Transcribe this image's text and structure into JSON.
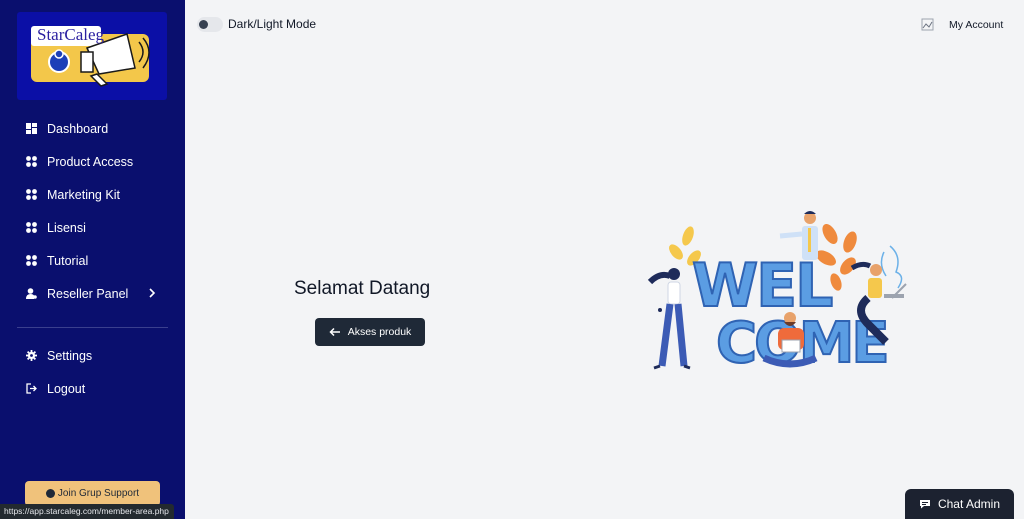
{
  "sidebar": {
    "logo_text": "StarCaleg",
    "items": [
      {
        "label": "Dashboard",
        "icon": "dashboard-icon"
      },
      {
        "label": "Product Access",
        "icon": "grid-icon"
      },
      {
        "label": "Marketing Kit",
        "icon": "grid-icon"
      },
      {
        "label": "Lisensi",
        "icon": "grid-icon"
      },
      {
        "label": "Tutorial",
        "icon": "grid-icon"
      },
      {
        "label": "Reseller Panel",
        "icon": "user-settings-icon",
        "has_submenu": true
      }
    ],
    "secondary_items": [
      {
        "label": "Settings",
        "icon": "gear-icon"
      },
      {
        "label": "Logout",
        "icon": "logout-icon"
      }
    ],
    "support_button": "Join Grup Support"
  },
  "topbar": {
    "mode_label": "Dark/Light Mode",
    "account_label": "My Account"
  },
  "main": {
    "title": "Selamat Datang",
    "button_label": "Akses produk",
    "illustration_words": [
      "WEL",
      "COME"
    ]
  },
  "chat": {
    "label": "Chat Admin"
  },
  "status_bar": {
    "url": "https://app.starcaleg.com/member-area.php"
  },
  "colors": {
    "sidebar_bg": "#0a0f6e",
    "main_bg": "#f3f4f6",
    "button_dark": "#1f2937",
    "support_bg": "#f0c27b"
  }
}
